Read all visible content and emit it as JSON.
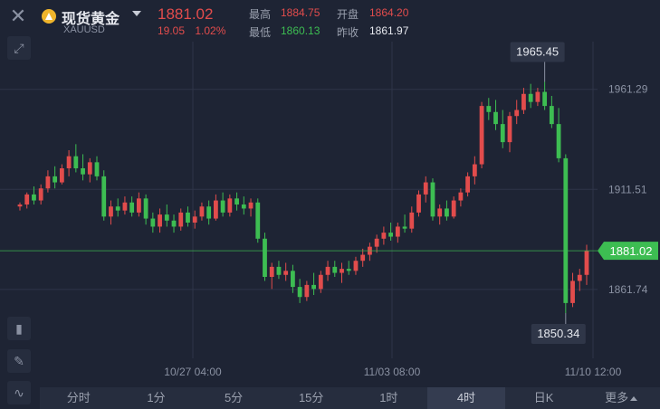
{
  "header": {
    "title": "现货黄金",
    "symbol": "XAUUSD",
    "price": "1881.02",
    "change_abs": "19.05",
    "change_pct": "1.02%",
    "high_label": "最高",
    "high": "1884.75",
    "open_label": "开盘",
    "open": "1864.20",
    "low_label": "最低",
    "low": "1860.13",
    "prev_close_label": "昨收",
    "prev_close": "1861.97"
  },
  "toolbar": {
    "close_icon": "close-icon",
    "expand_icon": "expand-icon",
    "indicator_icon": "indicator-icon",
    "draw_icon": "draw-icon",
    "chart_type_icon": "chart-type-icon"
  },
  "colors": {
    "up": "#e24c4c",
    "down": "#3dbd52",
    "background": "#1e2434",
    "grid": "#2e3548",
    "label_bg": "#2f3648"
  },
  "chart_data": {
    "type": "candlestick",
    "y_ticks": [
      "1961.29",
      "1911.51",
      "1861.74"
    ],
    "x_ticks": [
      "10/27 04:00",
      "11/03 08:00",
      "11/10 12:00"
    ],
    "current_price": "1881.02",
    "max_label": "1965.45",
    "min_label": "1850.34",
    "ylim": [
      1832,
      1985
    ],
    "candles": [
      [
        1903,
        1905,
        1901,
        1904
      ],
      [
        1904,
        1910,
        1902,
        1909
      ],
      [
        1909,
        1913,
        1904,
        1906
      ],
      [
        1906,
        1914,
        1904,
        1912
      ],
      [
        1912,
        1921,
        1910,
        1918
      ],
      [
        1918,
        1923,
        1912,
        1915
      ],
      [
        1915,
        1924,
        1914,
        1922
      ],
      [
        1922,
        1931,
        1918,
        1928
      ],
      [
        1928,
        1934,
        1920,
        1922
      ],
      [
        1922,
        1929,
        1916,
        1919
      ],
      [
        1919,
        1927,
        1915,
        1925
      ],
      [
        1925,
        1928,
        1916,
        1918
      ],
      [
        1918,
        1921,
        1896,
        1898
      ],
      [
        1898,
        1906,
        1894,
        1903
      ],
      [
        1903,
        1907,
        1898,
        1901
      ],
      [
        1901,
        1908,
        1899,
        1905
      ],
      [
        1905,
        1908,
        1898,
        1900
      ],
      [
        1900,
        1910,
        1898,
        1907
      ],
      [
        1907,
        1909,
        1894,
        1897
      ],
      [
        1897,
        1900,
        1890,
        1893
      ],
      [
        1893,
        1902,
        1890,
        1899
      ],
      [
        1899,
        1904,
        1893,
        1896
      ],
      [
        1896,
        1899,
        1890,
        1893
      ],
      [
        1893,
        1902,
        1891,
        1900
      ],
      [
        1900,
        1903,
        1893,
        1895
      ],
      [
        1895,
        1901,
        1892,
        1898
      ],
      [
        1898,
        1905,
        1896,
        1903
      ],
      [
        1903,
        1906,
        1894,
        1897
      ],
      [
        1897,
        1909,
        1896,
        1906
      ],
      [
        1906,
        1910,
        1898,
        1900
      ],
      [
        1900,
        1909,
        1898,
        1907
      ],
      [
        1907,
        1910,
        1901,
        1904
      ],
      [
        1904,
        1908,
        1899,
        1902
      ],
      [
        1902,
        1907,
        1898,
        1905
      ],
      [
        1905,
        1907,
        1885,
        1887
      ],
      [
        1887,
        1890,
        1866,
        1868
      ],
      [
        1868,
        1875,
        1862,
        1873
      ],
      [
        1873,
        1876,
        1867,
        1869
      ],
      [
        1869,
        1875,
        1866,
        1871
      ],
      [
        1871,
        1874,
        1860,
        1863
      ],
      [
        1863,
        1867,
        1855,
        1858
      ],
      [
        1858,
        1866,
        1856,
        1864
      ],
      [
        1864,
        1870,
        1859,
        1862
      ],
      [
        1862,
        1871,
        1860,
        1869
      ],
      [
        1869,
        1876,
        1866,
        1873
      ],
      [
        1873,
        1876,
        1868,
        1870
      ],
      [
        1870,
        1875,
        1865,
        1872
      ],
      [
        1872,
        1876,
        1869,
        1871
      ],
      [
        1871,
        1878,
        1869,
        1876
      ],
      [
        1876,
        1882,
        1873,
        1879
      ],
      [
        1879,
        1885,
        1876,
        1883
      ],
      [
        1883,
        1889,
        1880,
        1887
      ],
      [
        1887,
        1893,
        1884,
        1890
      ],
      [
        1890,
        1895,
        1886,
        1888
      ],
      [
        1888,
        1895,
        1885,
        1893
      ],
      [
        1893,
        1899,
        1890,
        1892
      ],
      [
        1892,
        1903,
        1890,
        1900
      ],
      [
        1900,
        1911,
        1898,
        1909
      ],
      [
        1909,
        1918,
        1905,
        1915
      ],
      [
        1915,
        1917,
        1896,
        1898
      ],
      [
        1898,
        1904,
        1894,
        1902
      ],
      [
        1902,
        1906,
        1896,
        1898
      ],
      [
        1898,
        1908,
        1897,
        1906
      ],
      [
        1906,
        1912,
        1903,
        1910
      ],
      [
        1910,
        1920,
        1908,
        1918
      ],
      [
        1918,
        1928,
        1914,
        1924
      ],
      [
        1924,
        1955,
        1922,
        1953
      ],
      [
        1953,
        1957,
        1946,
        1950
      ],
      [
        1950,
        1956,
        1941,
        1944
      ],
      [
        1944,
        1951,
        1932,
        1935
      ],
      [
        1935,
        1950,
        1930,
        1948
      ],
      [
        1948,
        1956,
        1944,
        1951
      ],
      [
        1951,
        1962,
        1949,
        1959
      ],
      [
        1959,
        1964,
        1952,
        1955
      ],
      [
        1955,
        1962,
        1953,
        1960
      ],
      [
        1960,
        1965,
        1951,
        1953
      ],
      [
        1953,
        1958,
        1942,
        1944
      ],
      [
        1944,
        1952,
        1925,
        1927
      ],
      [
        1927,
        1929,
        1850,
        1855
      ],
      [
        1855,
        1870,
        1853,
        1866
      ],
      [
        1866,
        1872,
        1861,
        1869
      ],
      [
        1869,
        1884,
        1864,
        1881
      ]
    ]
  },
  "tabs": [
    {
      "label": "分时",
      "active": false
    },
    {
      "label": "1分",
      "active": false
    },
    {
      "label": "5分",
      "active": false
    },
    {
      "label": "15分",
      "active": false
    },
    {
      "label": "1时",
      "active": false
    },
    {
      "label": "4时",
      "active": true
    },
    {
      "label": "日K",
      "active": false
    },
    {
      "label": "更多",
      "active": false
    }
  ]
}
